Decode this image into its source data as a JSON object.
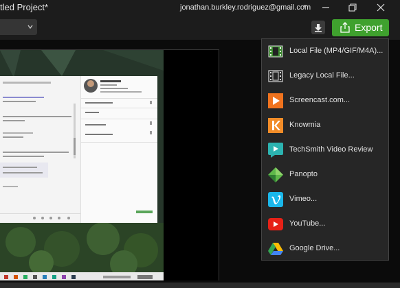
{
  "window": {
    "title": "tled Project*",
    "account": "jonathan.burkley.rodriguez@gmail.com"
  },
  "toolbar": {
    "export_label": "Export",
    "accent": "#3fa12e"
  },
  "preview": {
    "chat_header_name": "Jane Smith",
    "chat_lines": [
      "Search Messages",
      "People",
      "Files & Media",
      "Personal settings"
    ]
  },
  "export_menu": {
    "items": [
      {
        "label": "Local File (MP4/GIF/M4A)...",
        "icon": "film-icon"
      },
      {
        "label": "Legacy Local File...",
        "icon": "legacy-film-icon"
      },
      {
        "label": "Screencast.com...",
        "icon": "screencast-icon"
      },
      {
        "label": "Knowmia",
        "icon": "knowmia-icon"
      },
      {
        "label": "TechSmith Video Review",
        "icon": "video-review-icon"
      },
      {
        "label": "Panopto",
        "icon": "panopto-icon"
      },
      {
        "label": "Vimeo...",
        "icon": "vimeo-icon"
      },
      {
        "label": "YouTube...",
        "icon": "youtube-icon"
      },
      {
        "label": "Google Drive...",
        "icon": "google-drive-icon"
      }
    ]
  }
}
